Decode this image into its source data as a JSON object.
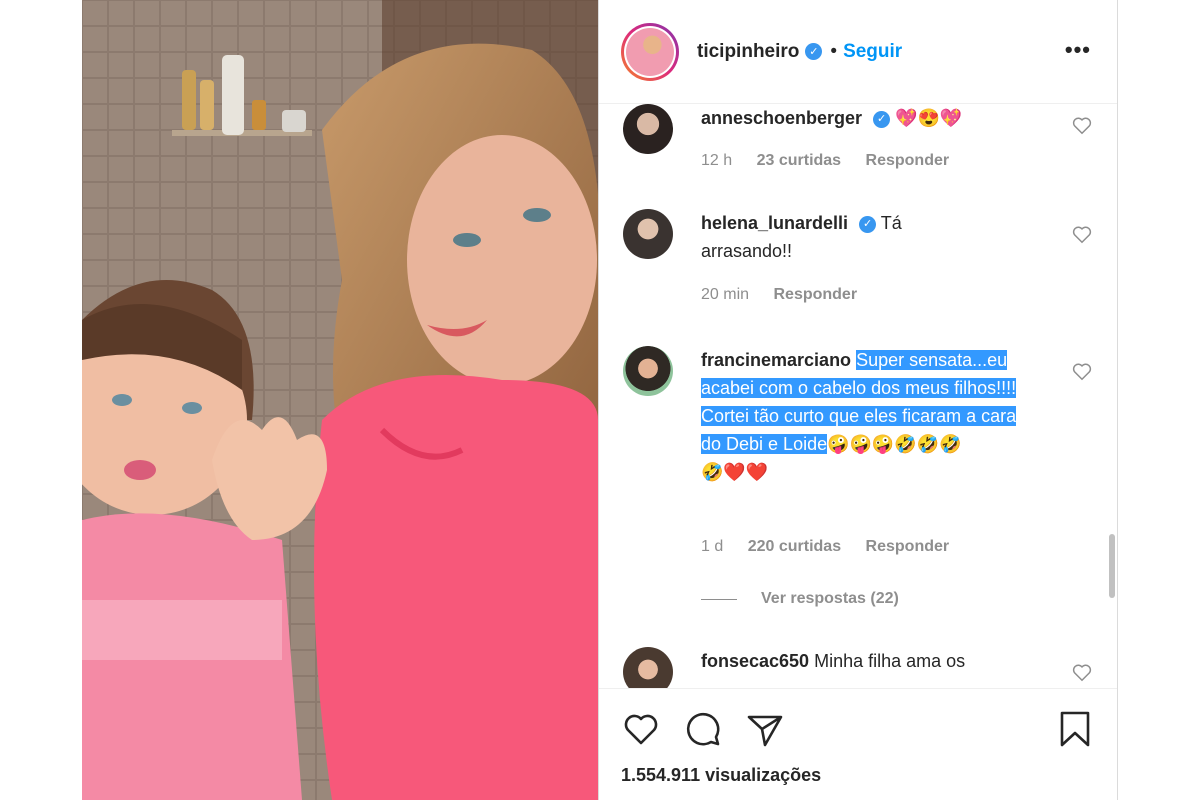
{
  "post": {
    "username": "ticipinheiro",
    "separator": "•",
    "follow_label": "Seguir",
    "more_label": "•••"
  },
  "comments": [
    {
      "username": "anneschoenberger",
      "verified": true,
      "text": "💖😍💖",
      "time": "12 h",
      "likes": "23 curtidas",
      "reply_label": "Responder"
    },
    {
      "username": "helena_lunardelli",
      "verified": true,
      "text": "Tá arrasando!!",
      "time": "20 min",
      "reply_label": "Responder"
    },
    {
      "username": "francinemarciano",
      "verified": false,
      "text": "Super sensata...eu acabei com o cabelo dos meus filhos!!!! Cortei tão curto que eles ficaram a cara do Debi e Loide",
      "emojis_line1": "🤪🤪🤪🤣🤣🤣",
      "emojis_line2": "🤣❤️❤️",
      "time": "1 d",
      "likes": "220 curtidas",
      "reply_label": "Responder",
      "view_replies": "Ver respostas (22)"
    },
    {
      "username": "fonsecac650",
      "verified": false,
      "text": "Minha filha ama os"
    }
  ],
  "footer": {
    "views": "1.554.911 visualizações"
  },
  "icons": {
    "like": "heart-icon",
    "comment": "comment-icon",
    "share": "paper-plane-icon",
    "save": "bookmark-icon",
    "verified": "verified-badge-icon"
  },
  "colors": {
    "link": "#0095f6",
    "verified": "#3897f0",
    "selection": "#3399ff",
    "text": "#262626",
    "muted": "#8e8e8e"
  }
}
